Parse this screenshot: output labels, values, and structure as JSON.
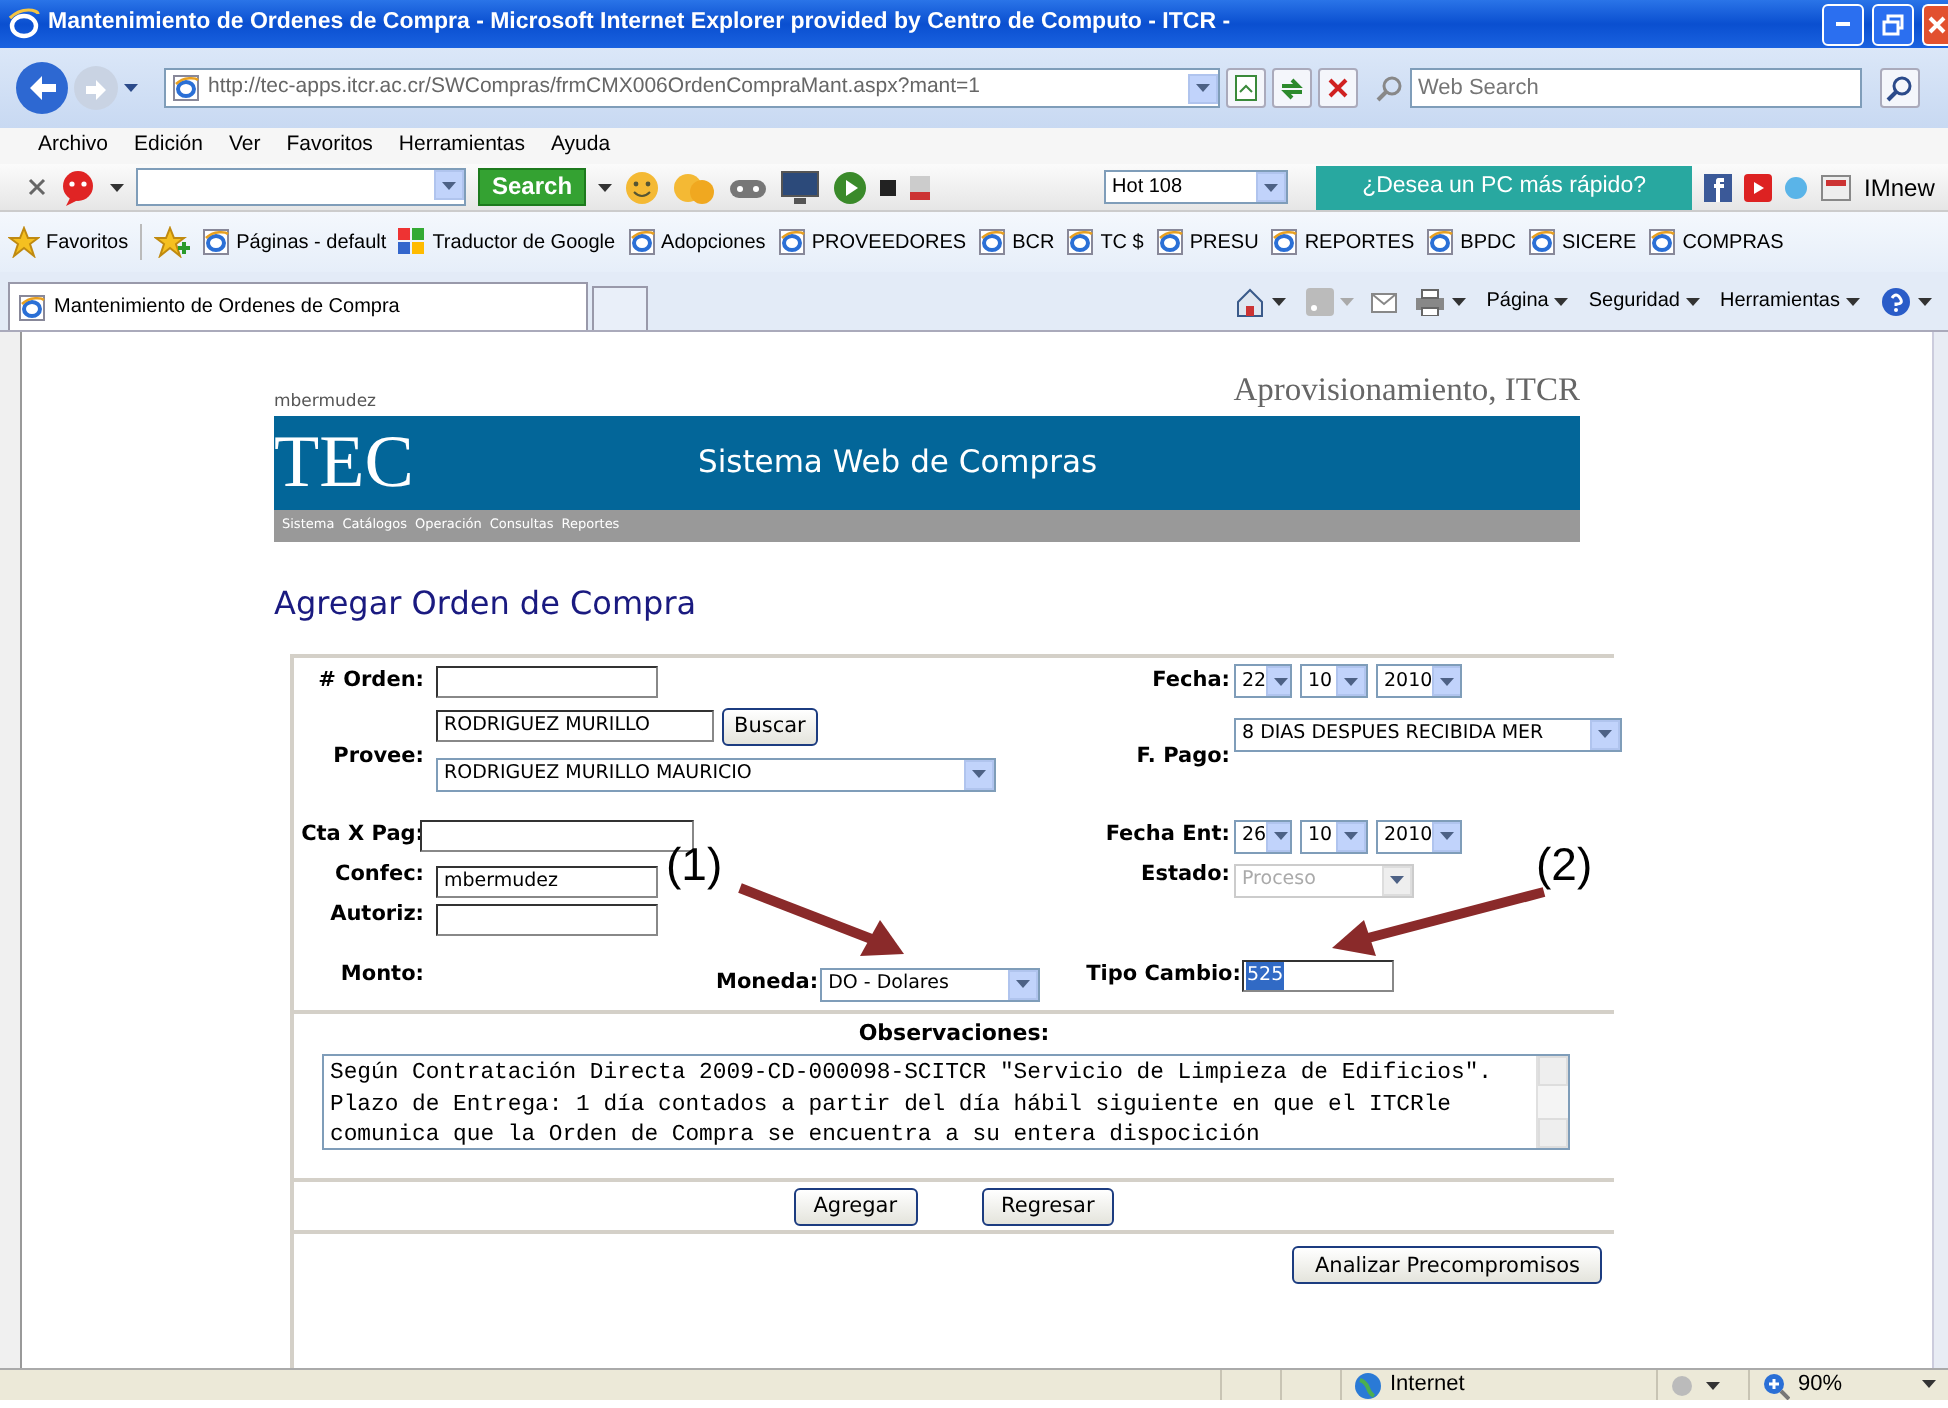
{
  "window": {
    "title": "Mantenimiento de Ordenes de Compra - Microsoft Internet Explorer provided by Centro de Computo - ITCR -"
  },
  "address_bar": {
    "url": "http://tec-apps.itcr.ac.cr/SWCompras/frmCMX006OrdenCompraMant.aspx?mant=1",
    "search_placeholder": "Web Search"
  },
  "menu": [
    "Archivo",
    "Edición",
    "Ver",
    "Favoritos",
    "Herramientas",
    "Ayuda"
  ],
  "toolbar": {
    "search_button": "Search",
    "station": "Hot 108",
    "promo": "¿Desea un PC más rápido?",
    "label": "IMnew"
  },
  "favorites": {
    "label": "Favoritos",
    "links": [
      {
        "label": "Páginas - default",
        "kind": "page"
      },
      {
        "label": "Traductor de Google",
        "kind": "translator"
      },
      {
        "label": "Adopciones",
        "kind": "page"
      },
      {
        "label": "PROVEEDORES",
        "kind": "page"
      },
      {
        "label": "BCR",
        "kind": "page"
      },
      {
        "label": "TC $",
        "kind": "page"
      },
      {
        "label": "PRESU",
        "kind": "page"
      },
      {
        "label": "REPORTES",
        "kind": "page"
      },
      {
        "label": "BPDC",
        "kind": "page"
      },
      {
        "label": "SICERE",
        "kind": "page"
      },
      {
        "label": "COMPRAS",
        "kind": "page"
      }
    ]
  },
  "tab": {
    "title": "Mantenimiento de Ordenes de Compra"
  },
  "command_bar": [
    "Página",
    "Seguridad",
    "Herramientas"
  ],
  "page": {
    "user": "mbermudez",
    "org": "Aprovisionamiento, ITCR",
    "logo": "TEC",
    "system_title": "Sistema Web de Compras",
    "nav": [
      "Sistema",
      "Catálogos",
      "Operación",
      "Consultas",
      "Reportes"
    ],
    "heading": "Agregar Orden de Compra"
  },
  "form": {
    "orden": {
      "label": "# Orden:"
    },
    "provee": {
      "label": "Provee:",
      "search": "RODRIGUEZ MURILLO",
      "button": "Buscar",
      "value": "RODRIGUEZ MURILLO MAURICIO"
    },
    "cta": {
      "label": "Cta X Pag:"
    },
    "confec": {
      "label": "Confec:",
      "value": "mbermudez"
    },
    "autoriz": {
      "label": "Autoriz:"
    },
    "monto": {
      "label": "Monto:"
    },
    "moneda": {
      "label": "Moneda:",
      "value": "DO - Dolares"
    },
    "fecha": {
      "label": "Fecha:",
      "day": "22",
      "month": "10",
      "year": "2010"
    },
    "fpago": {
      "label": "F. Pago:",
      "value": "8 DIAS DESPUES RECIBIDA MER"
    },
    "fecha_ent": {
      "label": "Fecha Ent:",
      "day": "26",
      "month": "10",
      "year": "2010"
    },
    "estado": {
      "label": "Estado:",
      "value": "Proceso",
      "disabled": true
    },
    "tipo_cambio": {
      "label": "Tipo Cambio:",
      "value": "525",
      "text_selected": true
    },
    "observaciones": {
      "label": "Observaciones:",
      "lines": [
        "Según Contratación Directa 2009-CD-000098-SCITCR \"Servicio de Limpieza de Edificios\".",
        "Plazo de Entrega: 1 día contados a partir del día hábil siguiente en que el ITCRle",
        "comunica que la Orden de Compra se encuentra a su entera dispocición"
      ]
    },
    "buttons": [
      "Agregar",
      "Regresar"
    ],
    "analyze_button": "Analizar Precompromisos"
  },
  "annotations": [
    {
      "label": "(1)"
    },
    {
      "label": "(2)"
    }
  ],
  "status_bar": {
    "zone": "Internet",
    "zoom": "90%"
  }
}
